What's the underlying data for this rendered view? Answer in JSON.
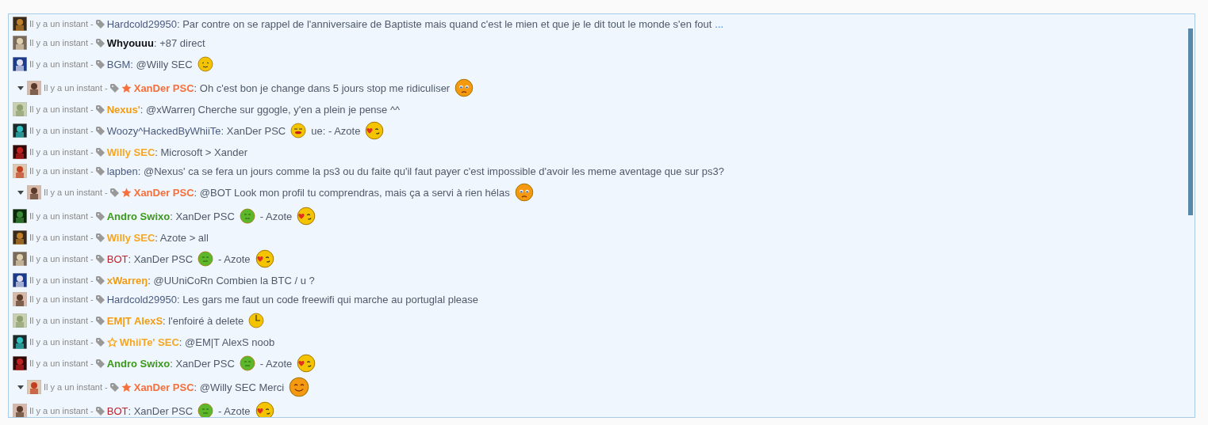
{
  "messages": [
    {
      "reply": false,
      "time": "Il y a un instant -",
      "user": "Hardcold29950",
      "bold": false,
      "color": "#4b5b80",
      "parts": [
        {
          "kind": "text",
          "text": ": Par contre on se rappel de l'anniversaire de Baptiste mais quand c'est le mien et que je le dit tout le monde s'en fout"
        },
        {
          "kind": "link",
          "text": "..."
        }
      ]
    },
    {
      "reply": false,
      "time": "Il y a un instant -",
      "user": "Whyouuu",
      "bold": true,
      "color": "#111111",
      "parts": [
        {
          "kind": "text",
          "text": ": +87 direct"
        }
      ]
    },
    {
      "reply": false,
      "time": "Il y a un instant -",
      "user": "BGM",
      "bold": false,
      "color": "#4b5b80",
      "parts": [
        {
          "kind": "text",
          "text": ": @Willy SEC"
        },
        {
          "kind": "wink"
        }
      ]
    },
    {
      "reply": true,
      "time": "Il y a un instant -",
      "star": {
        "kind": "filled"
      },
      "user": "XanDer PSC",
      "bold": true,
      "color": "#f5703c",
      "parts": [
        {
          "kind": "text",
          "text": ": Oh c'est bon je change dans 5 jours stop me ridiculiser"
        },
        {
          "kind": "sad"
        }
      ]
    },
    {
      "reply": false,
      "time": "Il y a un instant -",
      "user": "Nexus'",
      "bold": true,
      "color": "#f39c12",
      "parts": [
        {
          "kind": "text",
          "text": ": @xWarreŋ Cherche sur ggogle, y'en a plein je pense ^^"
        }
      ]
    },
    {
      "reply": false,
      "time": "Il y a un instant -",
      "user": "Woozy^HackedByWhiiTe",
      "bold": false,
      "color": "#4b5b80",
      "parts": [
        {
          "kind": "text",
          "text": ": XanDer PSC"
        },
        {
          "kind": "lips"
        },
        {
          "kind": "text",
          "text": "ue: - Azote"
        },
        {
          "kind": "love"
        }
      ]
    },
    {
      "reply": false,
      "time": "Il y a un instant -",
      "user": "Willy SEC",
      "bold": true,
      "color": "#f5a623",
      "parts": [
        {
          "kind": "text",
          "text": ": Microsoft > Xander"
        }
      ]
    },
    {
      "reply": false,
      "time": "Il y a un instant -",
      "user": "lapben",
      "bold": false,
      "color": "#4b5b80",
      "parts": [
        {
          "kind": "text",
          "text": ": @Nexus' ca se fera un jours comme la ps3 ou du faite qu'il faut payer c'est impossible d'avoir les meme aventage que sur ps3?"
        }
      ]
    },
    {
      "reply": true,
      "time": "Il y a un instant -",
      "star": {
        "kind": "filled"
      },
      "user": "XanDer PSC",
      "bold": true,
      "color": "#f5703c",
      "parts": [
        {
          "kind": "text",
          "text": ": @BOT Look mon profil tu comprendras, mais ça a servi à rien hélas"
        },
        {
          "kind": "sad"
        }
      ]
    },
    {
      "reply": false,
      "time": "Il y a un instant -",
      "user": "Andro Swixo",
      "bold": true,
      "color": "#3c9a1a",
      "parts": [
        {
          "kind": "text",
          "text": ": XanDer PSC"
        },
        {
          "kind": "neutral"
        },
        {
          "kind": "text",
          "text": "- Azote"
        },
        {
          "kind": "love"
        }
      ]
    },
    {
      "reply": false,
      "time": "Il y a un instant -",
      "user": "Willy SEC",
      "bold": true,
      "color": "#f5a623",
      "parts": [
        {
          "kind": "text",
          "text": ": Azote > all"
        }
      ]
    },
    {
      "reply": false,
      "time": "Il y a un instant -",
      "user": "BOT",
      "bold": false,
      "color": "#c0202a",
      "parts": [
        {
          "kind": "text",
          "text": ": XanDer PSC"
        },
        {
          "kind": "neutral"
        },
        {
          "kind": "text",
          "text": "- Azote"
        },
        {
          "kind": "love"
        }
      ]
    },
    {
      "reply": false,
      "time": "Il y a un instant -",
      "user": "xWarreŋ",
      "bold": true,
      "color": "#f39c12",
      "parts": [
        {
          "kind": "text",
          "text": ": @UUniCoRn Combien la BTC / u ?"
        }
      ]
    },
    {
      "reply": false,
      "time": "Il y a un instant -",
      "user": "Hardcold29950",
      "bold": false,
      "color": "#4b5b80",
      "parts": [
        {
          "kind": "text",
          "text": ": Les gars me faut un code freewifi qui marche au portuglal please"
        }
      ]
    },
    {
      "reply": false,
      "time": "Il y a un instant -",
      "user": "EM|T AlexS",
      "bold": true,
      "color": "#f39c12",
      "parts": [
        {
          "kind": "text",
          "text": ": l'enfoiré à delete"
        },
        {
          "kind": "clock"
        }
      ]
    },
    {
      "reply": false,
      "time": "Il y a un instant -",
      "star": {
        "kind": "outline"
      },
      "user": "WhiiTe' SEC",
      "bold": true,
      "color": "#f5a623",
      "parts": [
        {
          "kind": "text",
          "text": ": @EM|T AlexS noob"
        }
      ]
    },
    {
      "reply": false,
      "time": "Il y a un instant -",
      "user": "Andro Swixo",
      "bold": true,
      "color": "#3c9a1a",
      "parts": [
        {
          "kind": "text",
          "text": ": XanDer PSC"
        },
        {
          "kind": "neutral"
        },
        {
          "kind": "text",
          "text": "- Azote"
        },
        {
          "kind": "love"
        }
      ]
    },
    {
      "reply": true,
      "time": "Il y a un instant -",
      "star": {
        "kind": "filled"
      },
      "user": "XanDer PSC",
      "bold": true,
      "color": "#f5703c",
      "parts": [
        {
          "kind": "text",
          "text": ": @Willy SEC Merci"
        },
        {
          "kind": "happy"
        }
      ]
    },
    {
      "reply": false,
      "time": "Il y a un instant -",
      "user": "BOT",
      "bold": false,
      "color": "#c0202a",
      "parts": [
        {
          "kind": "text",
          "text": ": XanDer PSC"
        },
        {
          "kind": "neutral"
        },
        {
          "kind": "text",
          "text": "- Azote"
        },
        {
          "kind": "love"
        }
      ]
    }
  ]
}
